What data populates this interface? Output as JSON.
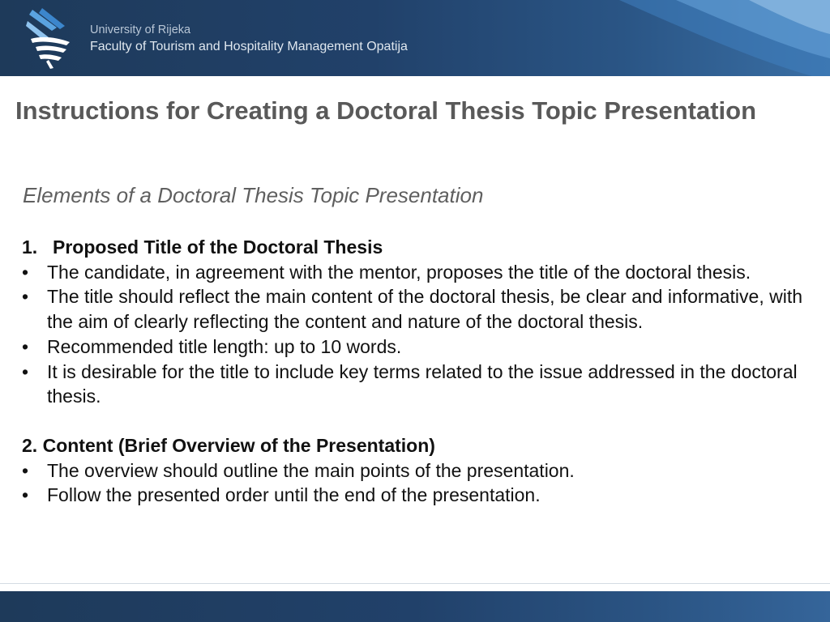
{
  "header": {
    "university": "University of Rijeka",
    "faculty": "Faculty of Tourism and Hospitality Management Opatija",
    "logo_icon": "faculty-logo-icon",
    "colors": {
      "band": "#21416a",
      "accent": "#3b7bbf"
    }
  },
  "slide": {
    "title": "Instructions for Creating a Doctoral Thesis Topic Presentation",
    "subtitle": "Elements of a Doctoral Thesis Topic Presentation",
    "sections": [
      {
        "number": "1.",
        "heading": "Proposed Title of the Doctoral Thesis",
        "bullets": [
          "The candidate, in agreement with the mentor, proposes the title of the doctoral thesis.",
          "The title should reflect the main content of the doctoral thesis, be clear and informative, with the aim of clearly reflecting the content and nature of the doctoral thesis.",
          "Recommended title length: up to 10 words.",
          "It is desirable for the title to include key terms related to the issue addressed in the doctoral thesis."
        ]
      },
      {
        "number": "2.",
        "heading": "Content (Brief Overview of the Presentation)",
        "bullets": [
          "The overview should outline the main points of the presentation.",
          "Follow the presented order until the end of the presentation."
        ]
      }
    ],
    "bullet_char": "•"
  }
}
